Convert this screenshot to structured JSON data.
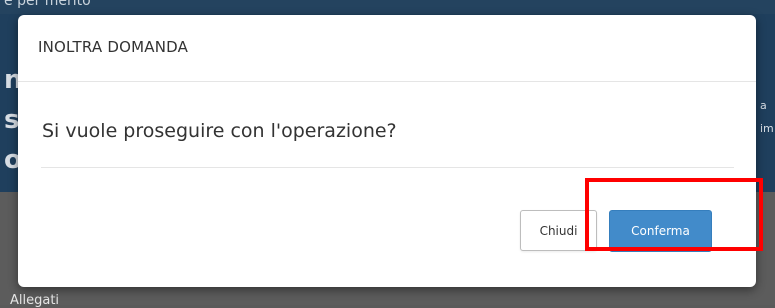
{
  "background": {
    "top_text": "e per merito",
    "right_glyphs": [
      "a",
      "im"
    ],
    "bottom_text": "Allegati"
  },
  "modal": {
    "title": "INOLTRA DOMANDA",
    "message": "Si vuole proseguire con l'operazione?",
    "buttons": {
      "close_label": "Chiudi",
      "confirm_label": "Conferma"
    }
  },
  "colors": {
    "primary": "#428bca",
    "highlight": "#ff0000",
    "overlay": "#5a5a5a"
  }
}
